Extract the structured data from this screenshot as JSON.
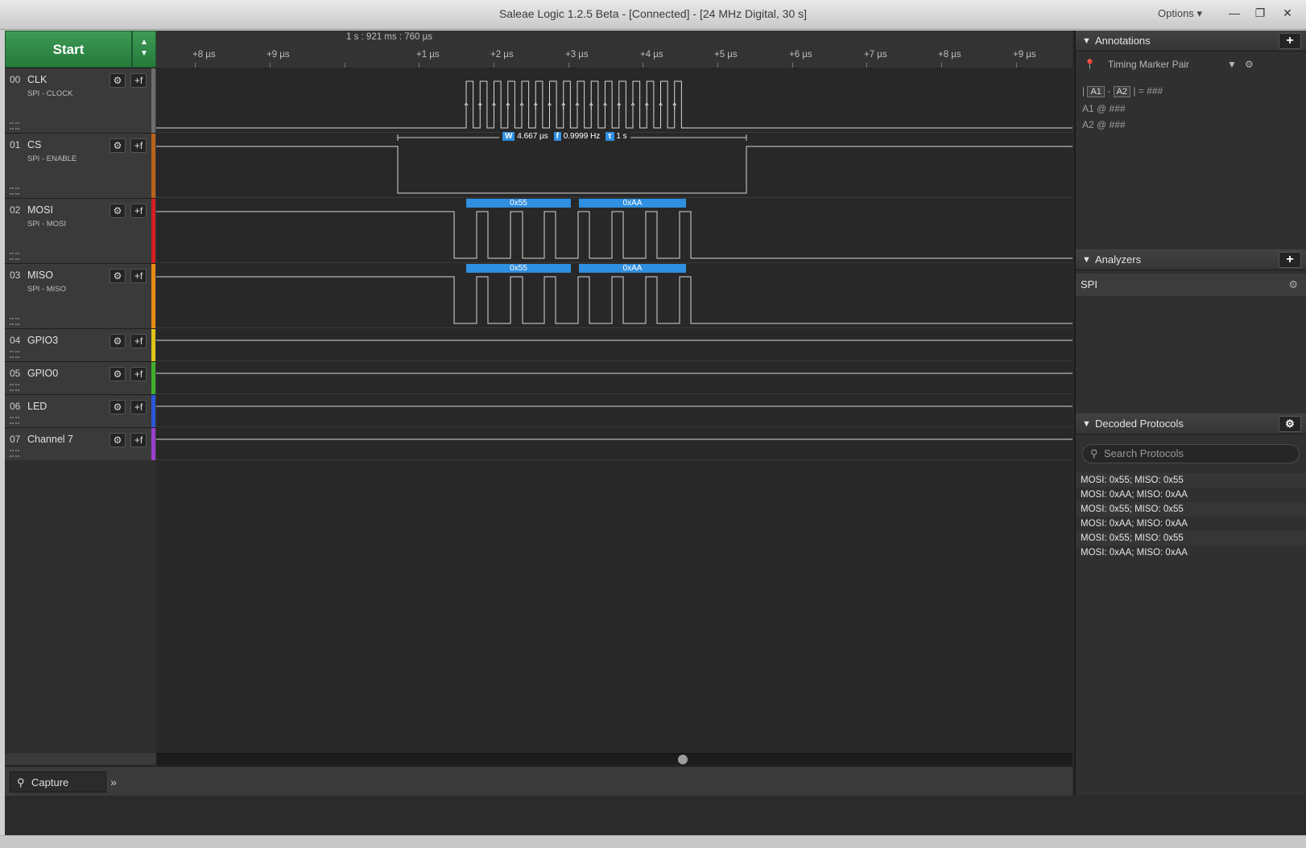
{
  "window": {
    "title": "Saleae Logic 1.2.5 Beta - [Connected] - [24 MHz Digital, 30 s]",
    "options_label": "Options",
    "minimize": "—",
    "restore": "❐",
    "close": "✕"
  },
  "toolbar": {
    "start_label": "Start"
  },
  "ruler": {
    "top_label": "1 s : 921 ms : 760 µs",
    "ticks": [
      "+8 µs",
      "+9 µs",
      "+1 µs",
      "+2 µs",
      "+3 µs",
      "+4 µs",
      "+5 µs",
      "+6 µs",
      "+7 µs",
      "+8 µs",
      "+9 µs"
    ]
  },
  "channels": [
    {
      "num": "00",
      "name": "CLK",
      "sub": "SPI - CLOCK",
      "color": "#6e6e6e"
    },
    {
      "num": "01",
      "name": "CS",
      "sub": "SPI - ENABLE",
      "color": "#b8621b"
    },
    {
      "num": "02",
      "name": "MOSI",
      "sub": "SPI - MOSI",
      "color": "#d02020"
    },
    {
      "num": "03",
      "name": "MISO",
      "sub": "SPI - MISO",
      "color": "#e58a10"
    },
    {
      "num": "04",
      "name": "GPIO3",
      "sub": "",
      "color": "#e0c21a"
    },
    {
      "num": "05",
      "name": "GPIO0",
      "sub": "",
      "color": "#3fae2a"
    },
    {
      "num": "06",
      "name": "LED",
      "sub": "",
      "color": "#2d55d8"
    },
    {
      "num": "07",
      "name": "Channel 7",
      "sub": "",
      "color": "#9a3ed0"
    }
  ],
  "measurement": {
    "width_tag": "W",
    "width": "4.667 µs",
    "freq_tag": "f",
    "freq": "0.9999 Hz",
    "period_tag": "τ",
    "period": "1 s"
  },
  "decoded_bytes": {
    "mosi": [
      "0x55",
      "0xAA"
    ],
    "miso": [
      "0x55",
      "0xAA"
    ]
  },
  "annotations": {
    "header": "Annotations",
    "marker_pair": "Timing Marker Pair",
    "a1": "A1",
    "a2": "A2",
    "formula_value": "= ###",
    "a1_line": "A1  @  ###",
    "a2_line": "A2  @  ###"
  },
  "analyzers": {
    "header": "Analyzers",
    "items": [
      "SPI"
    ]
  },
  "decoded_protocols": {
    "header": "Decoded Protocols",
    "search_placeholder": "Search Protocols",
    "rows": [
      "MOSI: 0x55;  MISO: 0x55",
      "MOSI: 0xAA;  MISO: 0xAA",
      "MOSI: 0x55;  MISO: 0x55",
      "MOSI: 0xAA;  MISO: 0xAA",
      "MOSI: 0x55;  MISO: 0x55",
      "MOSI: 0xAA;  MISO: 0xAA"
    ]
  },
  "bottom": {
    "capture_tab": "Capture",
    "more": "»"
  },
  "colors": {
    "accent_blue": "#2f8fe0",
    "start_green": "#2f8a45"
  }
}
